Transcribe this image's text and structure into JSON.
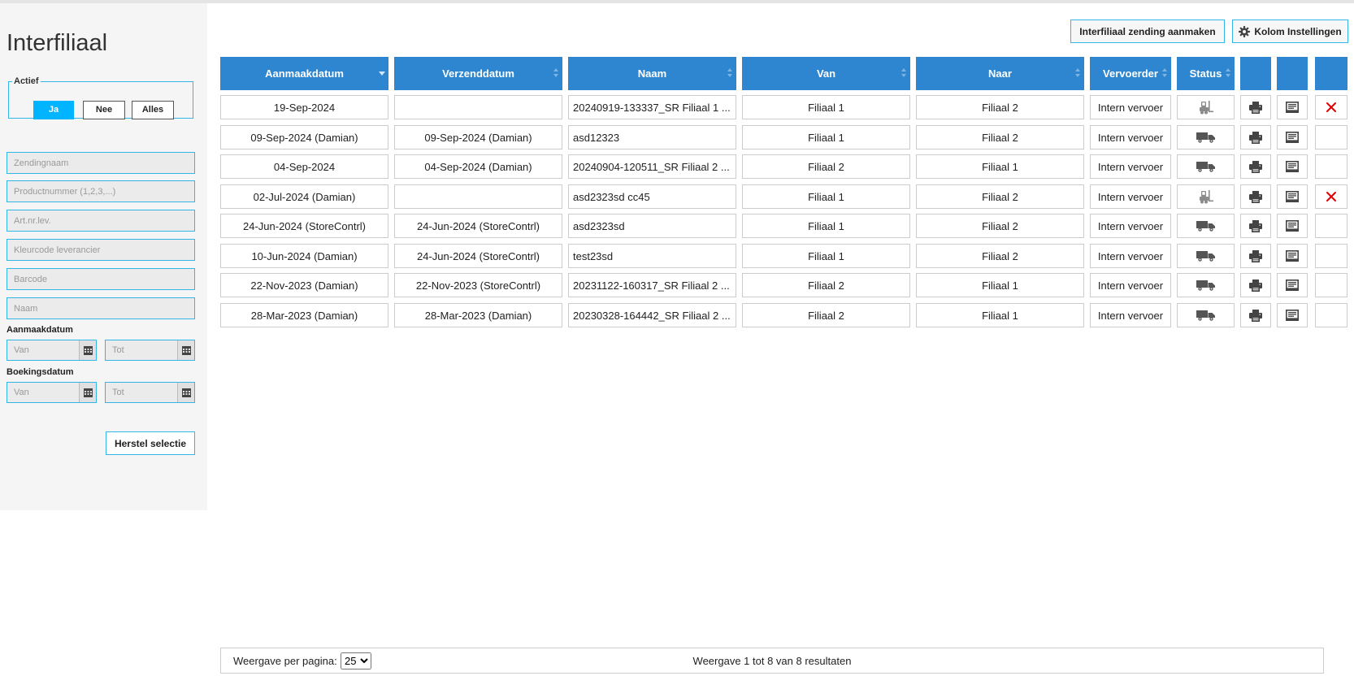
{
  "page": {
    "title": "Interfiliaal"
  },
  "filters": {
    "actief_label": "Actief",
    "actief_options": [
      "Ja",
      "Nee",
      "Alles"
    ],
    "actief_selected": "Ja",
    "zendingnaam_placeholder": "Zendingnaam",
    "productnummer_placeholder": "Productnummer (1,2,3,...)",
    "artnr_placeholder": "Art.nr.lev.",
    "kleurcode_placeholder": "Kleurcode leverancier",
    "barcode_placeholder": "Barcode",
    "naam_placeholder": "Naam",
    "aanmaakdatum_label": "Aanmaakdatum",
    "boekingsdatum_label": "Boekingsdatum",
    "van_placeholder": "Van",
    "tot_placeholder": "Tot",
    "reset_label": "Herstel selectie"
  },
  "toolbar": {
    "create_label": "Interfiliaal zending aanmaken",
    "columns_label": "Kolom Instellingen",
    "columns_icon": "gear-icon"
  },
  "table": {
    "headers": [
      "Aanmaakdatum",
      "Verzenddatum",
      "Naam",
      "Van",
      "Naar",
      "Vervoerder",
      "Status"
    ],
    "sorted_column": "Aanmaakdatum",
    "sort_direction": "descending",
    "rows": [
      {
        "aanmaakdatum": "19-Sep-2024",
        "verzenddatum": "",
        "naam": "20240919-133337_SR Filiaal 1 ...",
        "van": "Filiaal 1",
        "naar": "Filiaal 2",
        "vervoerder": "Intern vervoer",
        "status_icon": "forklift-icon",
        "deletable": true
      },
      {
        "aanmaakdatum": "09-Sep-2024 (Damian)",
        "verzenddatum": "09-Sep-2024 (Damian)",
        "naam": "asd12323",
        "van": "Filiaal 1",
        "naar": "Filiaal 2",
        "vervoerder": "Intern vervoer",
        "status_icon": "truck-icon",
        "deletable": false
      },
      {
        "aanmaakdatum": "04-Sep-2024",
        "verzenddatum": "04-Sep-2024 (Damian)",
        "naam": "20240904-120511_SR Filiaal 2 ...",
        "van": "Filiaal 2",
        "naar": "Filiaal 1",
        "vervoerder": "Intern vervoer",
        "status_icon": "truck-icon",
        "deletable": false
      },
      {
        "aanmaakdatum": "02-Jul-2024 (Damian)",
        "verzenddatum": "",
        "naam": "asd2323sd cc45",
        "van": "Filiaal 1",
        "naar": "Filiaal 2",
        "vervoerder": "Intern vervoer",
        "status_icon": "forklift-icon",
        "deletable": true
      },
      {
        "aanmaakdatum": "24-Jun-2024 (StoreContrl)",
        "verzenddatum": "24-Jun-2024 (StoreContrl)",
        "naam": "asd2323sd",
        "van": "Filiaal 1",
        "naar": "Filiaal 2",
        "vervoerder": "Intern vervoer",
        "status_icon": "truck-icon",
        "deletable": false
      },
      {
        "aanmaakdatum": "10-Jun-2024 (Damian)",
        "verzenddatum": "24-Jun-2024 (StoreContrl)",
        "naam": "test23sd",
        "van": "Filiaal 1",
        "naar": "Filiaal 2",
        "vervoerder": "Intern vervoer",
        "status_icon": "truck-icon",
        "deletable": false
      },
      {
        "aanmaakdatum": "22-Nov-2023 (Damian)",
        "verzenddatum": "22-Nov-2023 (StoreContrl)",
        "naam": "20231122-160317_SR Filiaal 2 ...",
        "van": "Filiaal 2",
        "naar": "Filiaal 1",
        "vervoerder": "Intern vervoer",
        "status_icon": "truck-icon",
        "deletable": false
      },
      {
        "aanmaakdatum": "28-Mar-2023 (Damian)",
        "verzenddatum": "28-Mar-2023 (Damian)",
        "naam": "20230328-164442_SR Filiaal 2 ...",
        "van": "Filiaal 2",
        "naar": "Filiaal 1",
        "vervoerder": "Intern vervoer",
        "status_icon": "truck-icon",
        "deletable": false
      }
    ],
    "action_icons": [
      "printer-icon",
      "label-print-icon",
      "delete-icon"
    ]
  },
  "footer": {
    "per_page_label": "Weergave per pagina:",
    "per_page_value": "25",
    "result_text": "Weergave 1 tot 8 van 8 resultaten"
  },
  "colors": {
    "header_bg": "#2e86d0",
    "active_button": "#00b4ff",
    "border_accent": "#33b5e5",
    "delete_red": "#e00000"
  }
}
